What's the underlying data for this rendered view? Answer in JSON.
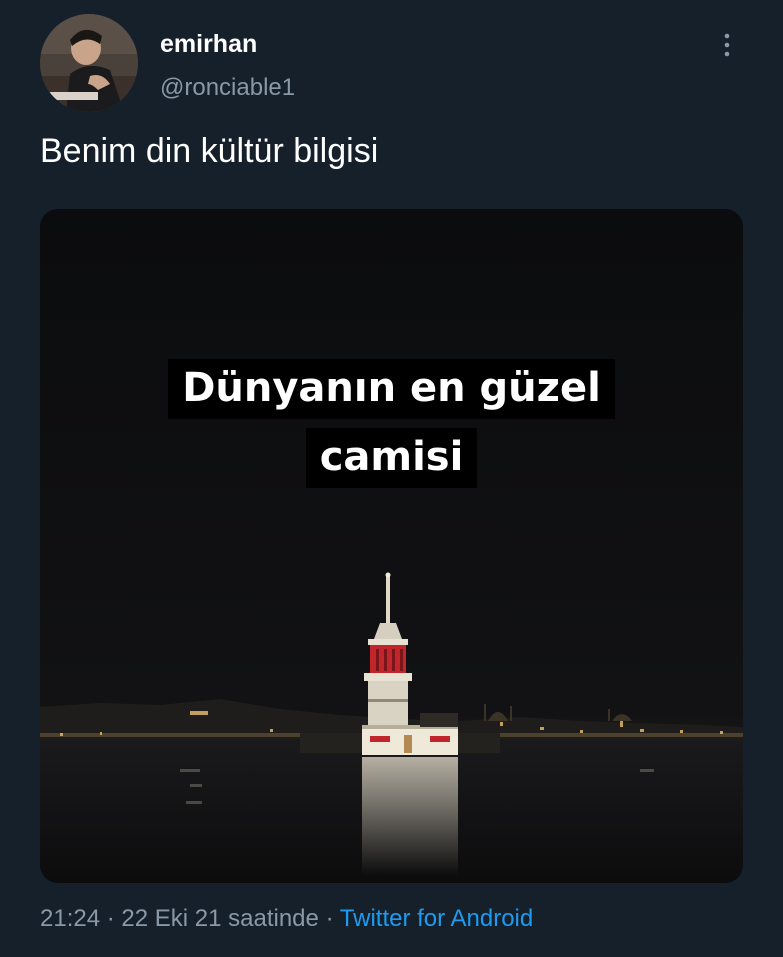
{
  "user": {
    "display_name": "emirhan",
    "handle": "@ronciable1"
  },
  "tweet": {
    "text": "Benim din kültür bilgisi",
    "media": {
      "caption_line_1": "Dünyanın en güzel",
      "caption_line_2": "camisi"
    },
    "time": "21:24",
    "separator": "·",
    "date": "22 Eki 21 saatinde",
    "source": "Twitter for Android"
  },
  "icons": {
    "more": "more-vertical-icon",
    "avatar": "user-avatar"
  },
  "colors": {
    "background": "#15202b",
    "secondary_text": "#8b98a5",
    "link": "#1d9bf0",
    "tower_red": "#c0262c"
  }
}
